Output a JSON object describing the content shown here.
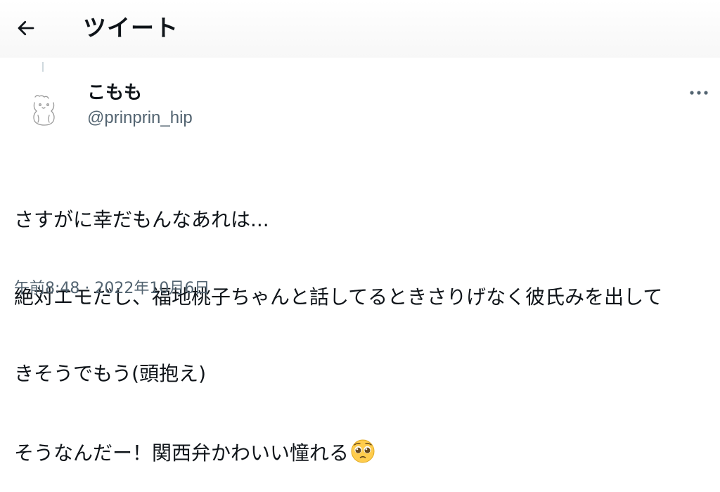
{
  "header": {
    "title": "ツイート",
    "back_icon": "arrow-left-icon"
  },
  "author": {
    "display_name": "こもも",
    "handle": "@prinprin_hip",
    "avatar_icon": "hamster-sketch-avatar"
  },
  "more_icon": "more-horizontal-icon",
  "tweet": {
    "lines": [
      "さすがに幸だもんなあれは...",
      "絶対エモだし、福地桃子ちゃんと話してるときさりげなく彼氏みを出して",
      "きそうでもう(頭抱え)",
      "そうなんだー！関西弁かわいい憧れる"
    ],
    "emoji": "pleading-face-emoji"
  },
  "timestamp": "午前8:48 · 2022年10月6日",
  "colors": {
    "text": "#0f1419",
    "secondary": "#536471"
  }
}
